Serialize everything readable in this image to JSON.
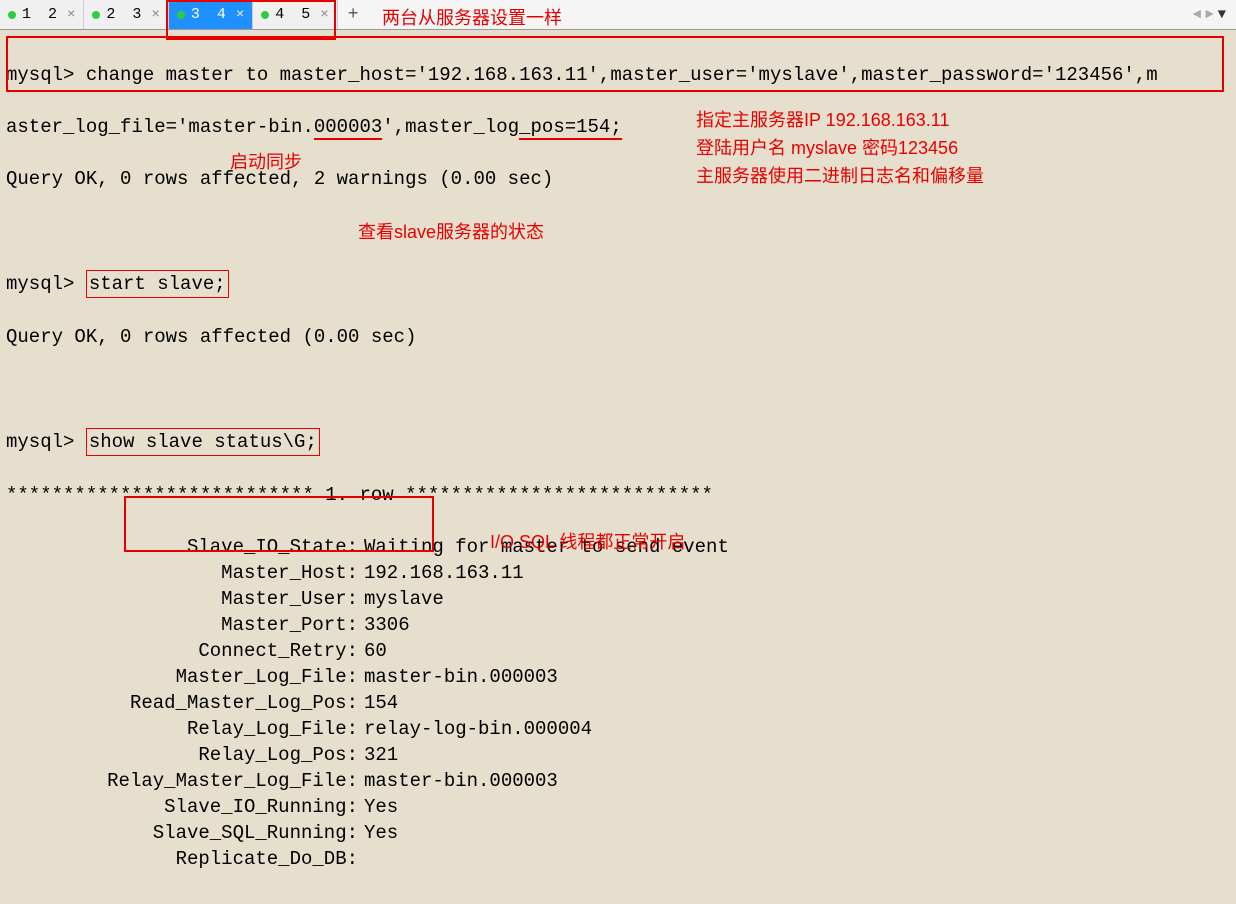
{
  "tabs": {
    "items": [
      {
        "label": "1 2",
        "active": false
      },
      {
        "label": "2 3",
        "active": false
      },
      {
        "label": "3 4",
        "active": true
      },
      {
        "label": "4 5",
        "active": false
      }
    ],
    "plus": "+"
  },
  "nav": {
    "left": "◄",
    "right": "►",
    "down": "▼"
  },
  "annotations": {
    "tabs_note": "两台从服务器设置一样",
    "change_master_notes": "指定主服务器IP 192.168.163.11\n登陆用户名 myslave    密码123456\n主服务器使用二进制日志名和偏移量",
    "start_slave_note": "启动同步",
    "show_status_note": "查看slave服务器的状态",
    "running_note": "I/O  SQL 线程都正常开启"
  },
  "terminal": {
    "prompt": "mysql>",
    "change_master_line1": "change master to master_host='192.168.163.11',master_user='myslave',master_password='123456',m",
    "change_master_line2_a": "aster_log_file='master-bin.",
    "change_master_line2_b": "000003",
    "change_master_line2_c": "',master_log",
    "change_master_line2_d": "_",
    "change_master_line2_e": "pos=154;",
    "query_ok_warnings": "Query OK, 0 rows affected, 2 warnings (0.00 sec)",
    "start_slave": "start slave;",
    "query_ok": "Query OK, 0 rows affected (0.00 sec)",
    "show_slave": "show slave status\\G;",
    "row_header": "*************************** 1. row ***************************",
    "status": [
      {
        "k": "Slave_IO_State",
        "v": "Waiting for master to send event"
      },
      {
        "k": "Master_Host",
        "v": "192.168.163.11"
      },
      {
        "k": "Master_User",
        "v": "myslave"
      },
      {
        "k": "Master_Port",
        "v": "3306"
      },
      {
        "k": "Connect_Retry",
        "v": "60"
      },
      {
        "k": "Master_Log_File",
        "v": "master-bin.000003"
      },
      {
        "k": "Read_Master_Log_Pos",
        "v": "154"
      },
      {
        "k": "Relay_Log_File",
        "v": "relay-log-bin.000004"
      },
      {
        "k": "Relay_Log_Pos",
        "v": "321"
      },
      {
        "k": "Relay_Master_Log_File",
        "v": "master-bin.000003"
      },
      {
        "k": "Slave_IO_Running",
        "v": "Yes"
      },
      {
        "k": "Slave_SQL_Running",
        "v": "Yes"
      },
      {
        "k": "Replicate_Do_DB",
        "v": ""
      }
    ]
  }
}
